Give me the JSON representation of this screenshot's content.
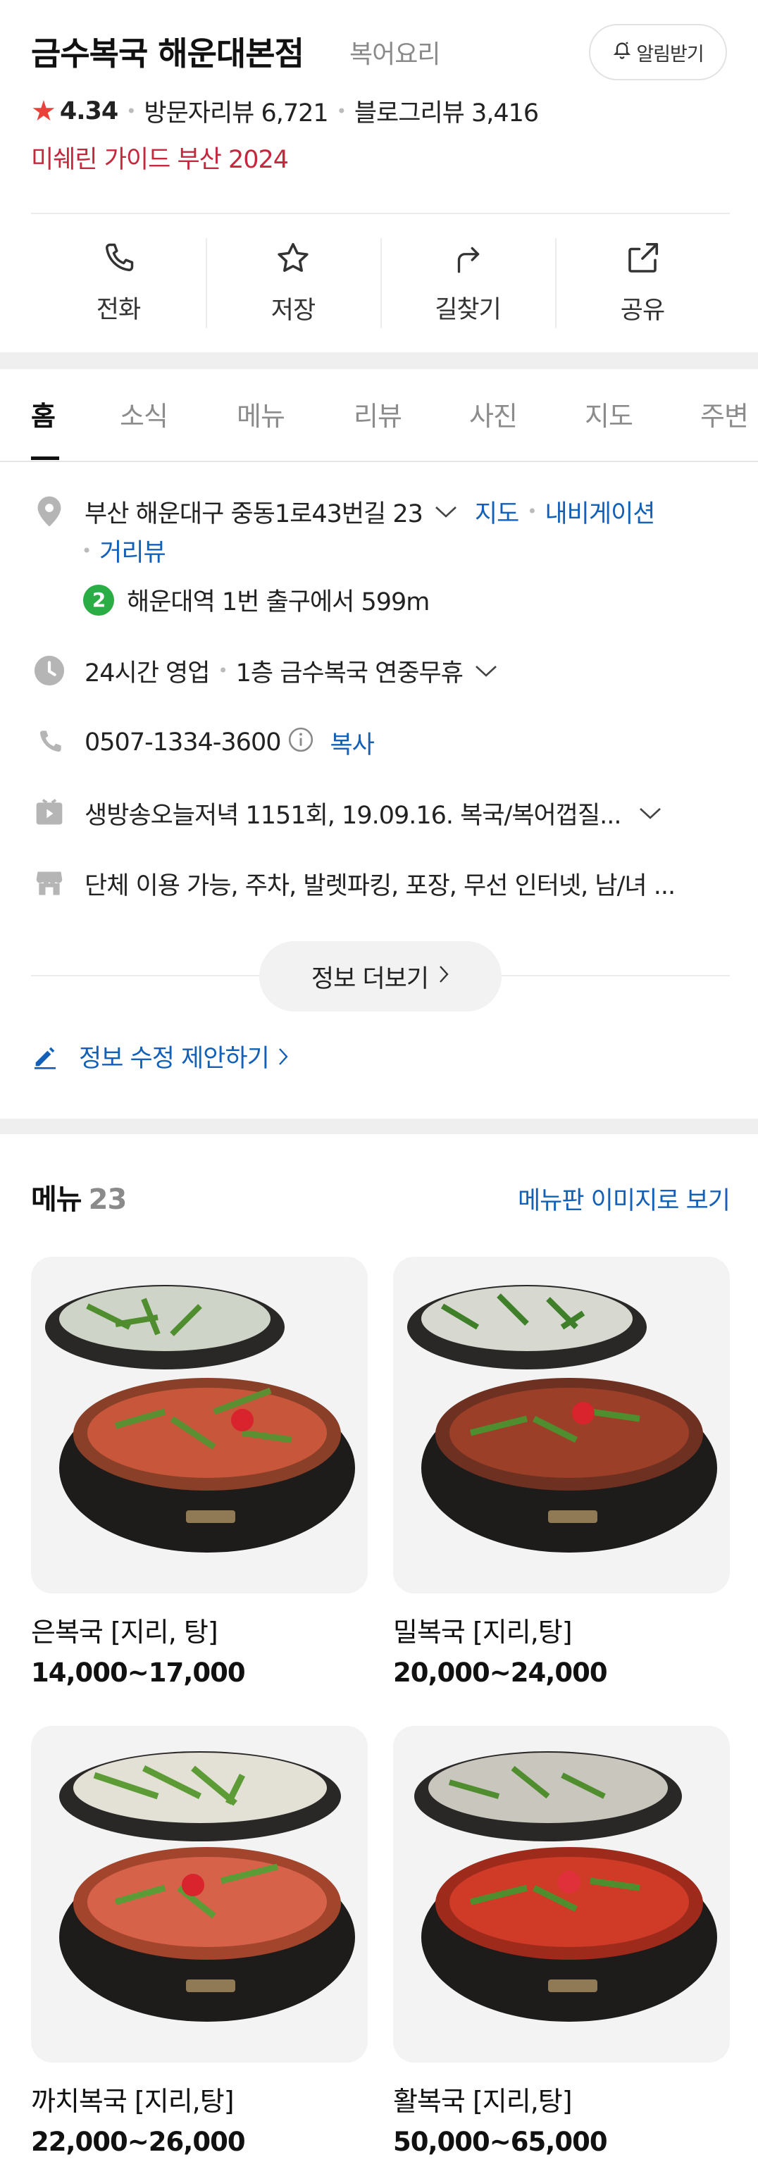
{
  "place": {
    "name": "금수복국 해운대본점",
    "category": "복어요리",
    "notify_label": "알림받기",
    "rating": "4.34",
    "visitor_reviews": "방문자리뷰 6,721",
    "blog_reviews": "블로그리뷰 3,416",
    "award": "미쉐린 가이드 부산 2024"
  },
  "actions": [
    {
      "label": "전화",
      "icon": "phone-icon"
    },
    {
      "label": "저장",
      "icon": "star-outline-icon"
    },
    {
      "label": "길찾기",
      "icon": "directions-icon"
    },
    {
      "label": "공유",
      "icon": "share-icon"
    }
  ],
  "tabs": [
    "홈",
    "소식",
    "메뉴",
    "리뷰",
    "사진",
    "지도",
    "주변"
  ],
  "info": {
    "address": "부산 해운대구 중동1로43번길 23",
    "map_link": "지도",
    "navi_link": "내비게이션",
    "street_link": "거리뷰",
    "subway_line": "2",
    "subway_text": "해운대역 1번 출구에서 599m",
    "hours": "24시간 영업",
    "hours_note": "1층 금수복국 연중무휴",
    "phone": "0507-1334-3600",
    "copy_label": "복사",
    "tv": "생방송오늘저녁 1151회, 19.09.16. 복국/복어껍질...",
    "amenities": "단체 이용 가능, 주차, 발렛파킹, 포장, 무선 인터넷, 남/녀 ...",
    "more_label": "정보 더보기",
    "edit_label": "정보 수정 제안하기"
  },
  "menu": {
    "title": "메뉴",
    "count": "23",
    "board_link": "메뉴판 이미지로 보기",
    "items": [
      {
        "name": "은복국 [지리, 탕]",
        "price": "14,000~17,000"
      },
      {
        "name": "밀복국 [지리,탕]",
        "price": "20,000~24,000"
      },
      {
        "name": "까치복국 [지리,탕]",
        "price": "22,000~26,000"
      },
      {
        "name": "활복국 [지리,탕]",
        "price": "50,000~65,000"
      }
    ]
  },
  "colors": {
    "accent_red": "#e8423b",
    "award_red": "#c5283d",
    "link_blue": "#1360b8",
    "subway_green": "#2bad45"
  }
}
